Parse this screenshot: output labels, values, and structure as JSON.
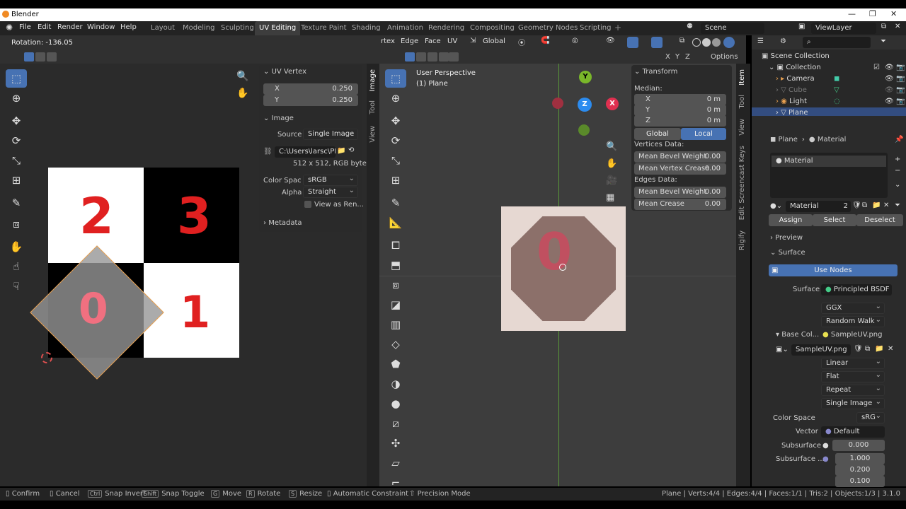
{
  "window": {
    "title": "Blender"
  },
  "menu": [
    "File",
    "Edit",
    "Render",
    "Window",
    "Help"
  ],
  "workspaces": [
    "Layout",
    "Modeling",
    "Sculpting",
    "UV Editing",
    "Texture Paint",
    "Shading",
    "Animation",
    "Rendering",
    "Compositing",
    "Geometry Nodes",
    "Scripting"
  ],
  "active_workspace": "UV Editing",
  "scene": "Scene",
  "view_layer": "ViewLayer",
  "uv_editor": {
    "rotation": "Rotation: -136.05",
    "uv_vertex_title": "UV Vertex",
    "x_label": "X",
    "x_value": "0.250",
    "y_label": "Y",
    "y_value": "0.250",
    "image_title": "Image",
    "source_label": "Source",
    "source_value": "Single Image",
    "path": "C:\\Users\\larsc\\PR...",
    "info": "512 x 512,  RGB byte",
    "colorspace_label": "Color Spac",
    "colorspace_value": "sRGB",
    "alpha_label": "Alpha",
    "alpha_value": "Straight",
    "view_as_render": "View as Ren...",
    "metadata_title": "Metadata",
    "tabs": [
      "Image",
      "Tool",
      "View"
    ],
    "texture_numbers": [
      "2",
      "3",
      "0",
      "1"
    ]
  },
  "viewport": {
    "menus": [
      "rtex",
      "Edge",
      "Face",
      "UV"
    ],
    "orientation": "Global",
    "options": "Options",
    "axes": [
      "X",
      "Y",
      "Z"
    ],
    "perspective": "User Perspective",
    "object": "(1) Plane",
    "gizmo": {
      "y": "Y",
      "z": "Z",
      "x": "X"
    },
    "transform_title": "Transform",
    "median": "Median:",
    "mx": "X",
    "mx_value": "0 m",
    "my": "Y",
    "my_value": "0 m",
    "mz": "Z",
    "mz_value": "0 m",
    "global": "Global",
    "local": "Local",
    "vertices_data": "Vertices Data:",
    "mean_bevel_weight": "Mean Bevel Weight",
    "mbw_value": "0.00",
    "mean_vertex_crease": "Mean Vertex Crease",
    "mvc_value": "0.00",
    "edges_data": "Edges Data:",
    "mean_bevel_weight_e": "Mean Bevel Weight",
    "mbwe_value": "0.00",
    "mean_crease": "Mean Crease",
    "mc_value": "0.00",
    "tabs": [
      "Item",
      "Tool",
      "View",
      "Screencast Keys",
      "Edit",
      "Rigify"
    ],
    "plane_number": "0"
  },
  "outliner": {
    "root": "Scene Collection",
    "collection": "Collection",
    "items": [
      "Camera",
      "Cube",
      "Light",
      "Plane"
    ]
  },
  "properties": {
    "breadcrumb_object": "Plane",
    "breadcrumb_material": "Material",
    "slot": "Material",
    "material_name": "Material",
    "users": "2",
    "assign": "Assign",
    "select": "Select",
    "deselect": "Deselect",
    "preview": "Preview",
    "surface_panel": "Surface",
    "use_nodes": "Use Nodes",
    "surface_label": "Surface",
    "surface_value": "Principled BSDF",
    "distribution": "GGX",
    "subsurface_method": "Random Walk",
    "base_color_label": "Base Col...",
    "base_color_value": "SampleUV.png",
    "image_name": "SampleUV.png",
    "interpolation": "Linear",
    "projection": "Flat",
    "extension": "Repeat",
    "image_source": "Single Image",
    "colorspace_label": "Color Space",
    "colorspace_value": "sRG",
    "vector_label": "Vector",
    "vector_value": "Default",
    "subsurface_label": "Subsurface",
    "subsurface_value": "0.000",
    "subsurface_radius_label": "Subsurface ...",
    "radius": [
      "1.000",
      "0.200",
      "0.100"
    ]
  },
  "status": {
    "items": [
      "Confirm",
      "Cancel",
      "Snap Invert",
      "Snap Toggle",
      "Move",
      "Rotate",
      "Resize",
      "Automatic Constraint",
      "Precision Mode"
    ],
    "keys": [
      "",
      "",
      "Ctrl",
      "Shift",
      "G",
      "R",
      "S",
      "",
      ""
    ],
    "stats": "Plane | Verts:4/4 | Edges:4/4 | Faces:1/1 | Tris:2 | Objects:1/3 | 3.1.0"
  },
  "colors": {
    "accent": "#4772b3",
    "uv_outline": "#e8a050",
    "number_red": "#e02020"
  }
}
